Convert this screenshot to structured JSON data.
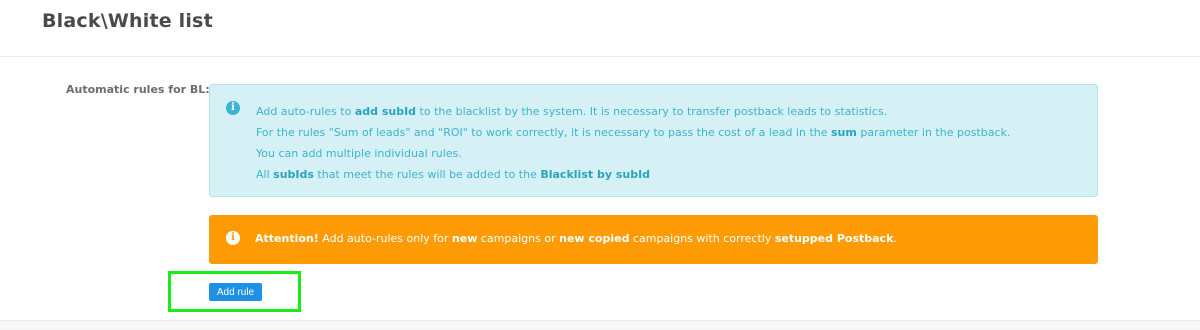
{
  "header": {
    "title": "Black\\White list"
  },
  "form": {
    "label": "Automatic rules for BL:",
    "info": {
      "icon": "info-icon",
      "line1": {
        "p1": "Add auto-rules to ",
        "b1": "add subId",
        "p2": " to the blacklist by the system. It is necessary to transfer postback leads to statistics."
      },
      "line2": {
        "p1": "For the rules \"Sum of leads\" and \"ROI\" to work correctly, it is necessary to pass the cost of a lead in the ",
        "b1": "sum",
        "p2": " parameter in the postback."
      },
      "line3": {
        "p1": "You can add multiple individual rules."
      },
      "line4": {
        "p1": "All ",
        "b1": "subIds",
        "p2": " that meet the rules will be added to the ",
        "b2": "Blacklist by subId"
      }
    },
    "warning": {
      "icon": "info-icon",
      "b1": "Attention!",
      "p1": " Add auto-rules only for ",
      "b2": "new",
      "p2": " campaigns or ",
      "b3": "new copied",
      "p3": " campaigns with correctly ",
      "b4": "setupped Postback",
      "p4": "."
    },
    "add_rule_label": "Add rule"
  },
  "colors": {
    "info_bg": "#d5f1f6",
    "info_text": "#3bb4cc",
    "warning_bg": "#ff9b04",
    "button_bg": "#1e90e6",
    "highlight": "#16ee16"
  }
}
